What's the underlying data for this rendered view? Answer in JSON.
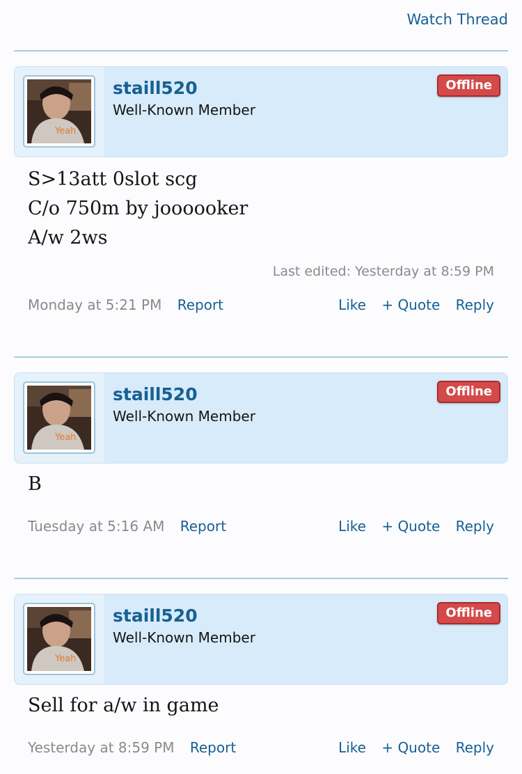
{
  "header": {
    "watch_label": "Watch Thread"
  },
  "posts": [
    {
      "username": "staill520",
      "user_title": "Well-Known Member",
      "status": "Offline",
      "lines": [
        "S>13att 0slot scg",
        "C/o 750m by joooooker",
        "A/w 2ws"
      ],
      "edited": "Last edited: Yesterday at 8:59 PM",
      "date": "Monday at 5:21 PM",
      "report": "Report",
      "like": "Like",
      "quote": "+ Quote",
      "reply": "Reply"
    },
    {
      "username": "staill520",
      "user_title": "Well-Known Member",
      "status": "Offline",
      "lines": [
        "B"
      ],
      "date": "Tuesday at 5:16 AM",
      "report": "Report",
      "like": "Like",
      "quote": "+ Quote",
      "reply": "Reply"
    },
    {
      "username": "staill520",
      "user_title": "Well-Known Member",
      "status": "Offline",
      "lines": [
        "Sell for a/w in game"
      ],
      "date": "Yesterday at 8:59 PM",
      "report": "Report",
      "like": "Like",
      "quote": "+ Quote",
      "reply": "Reply"
    }
  ]
}
